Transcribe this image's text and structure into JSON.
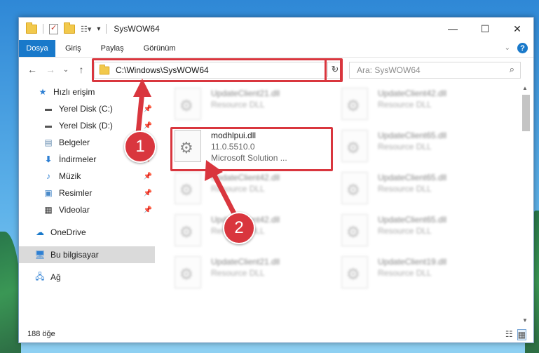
{
  "window": {
    "title": "SysWOW64",
    "minimize": "—",
    "maximize": "☐",
    "close": "✕"
  },
  "ribbon": {
    "tabs": [
      "Dosya",
      "Giriş",
      "Paylaş",
      "Görünüm"
    ],
    "help": "?"
  },
  "nav": {
    "back": "←",
    "forward": "→",
    "recent": "⌄",
    "up": "↑",
    "address": "C:\\Windows\\SysWOW64",
    "refresh": "↻"
  },
  "search": {
    "placeholder": "Ara: SysWOW64"
  },
  "sidebar": {
    "items": [
      {
        "label": "Hızlı erişim",
        "icon": "star-icon"
      },
      {
        "label": "Yerel Disk (C:)",
        "icon": "drive-icon",
        "pinned": true
      },
      {
        "label": "Yerel Disk (D:)",
        "icon": "drive-icon",
        "pinned": true
      },
      {
        "label": "Belgeler",
        "icon": "documents-icon",
        "pinned": true
      },
      {
        "label": "İndirmeler",
        "icon": "download-icon",
        "pinned": true
      },
      {
        "label": "Müzik",
        "icon": "music-icon",
        "pinned": true
      },
      {
        "label": "Resimler",
        "icon": "pictures-icon",
        "pinned": true
      },
      {
        "label": "Videolar",
        "icon": "video-icon",
        "pinned": true
      },
      {
        "label": "OneDrive",
        "icon": "cloud-icon"
      },
      {
        "label": "Bu bilgisayar",
        "icon": "computer-icon",
        "selected": true
      },
      {
        "label": "Ağ",
        "icon": "network-icon"
      }
    ]
  },
  "files": {
    "left": [
      {
        "name": "UpdateClient21.dll",
        "sub": "Resource DLL",
        "blurred": true
      },
      {
        "name": "modhlpui.dll",
        "sub": "11.0.5510.0",
        "sub2": "Microsoft Solution ...",
        "blurred": false
      },
      {
        "name": "UpdateClient42.dll",
        "sub": "Resource DLL",
        "blurred": true
      },
      {
        "name": "UpdateClient42.dll",
        "sub": "Resource DLL",
        "blurred": true
      },
      {
        "name": "UpdateClient21.dll",
        "sub": "Resource DLL",
        "blurred": true
      }
    ],
    "right": [
      {
        "name": "UpdateClient42.dll",
        "sub": "Resource DLL"
      },
      {
        "name": "UpdateClient65.dll",
        "sub": "Resource DLL"
      },
      {
        "name": "UpdateClient65.dll",
        "sub": "Resource DLL"
      },
      {
        "name": "UpdateClient65.dll",
        "sub": "Resource DLL"
      },
      {
        "name": "UpdateClient19.dll",
        "sub": "Resource DLL"
      }
    ]
  },
  "status": {
    "count": "188 öğe"
  },
  "annotations": {
    "badge1": "1",
    "badge2": "2",
    "color": "#d9363e"
  }
}
